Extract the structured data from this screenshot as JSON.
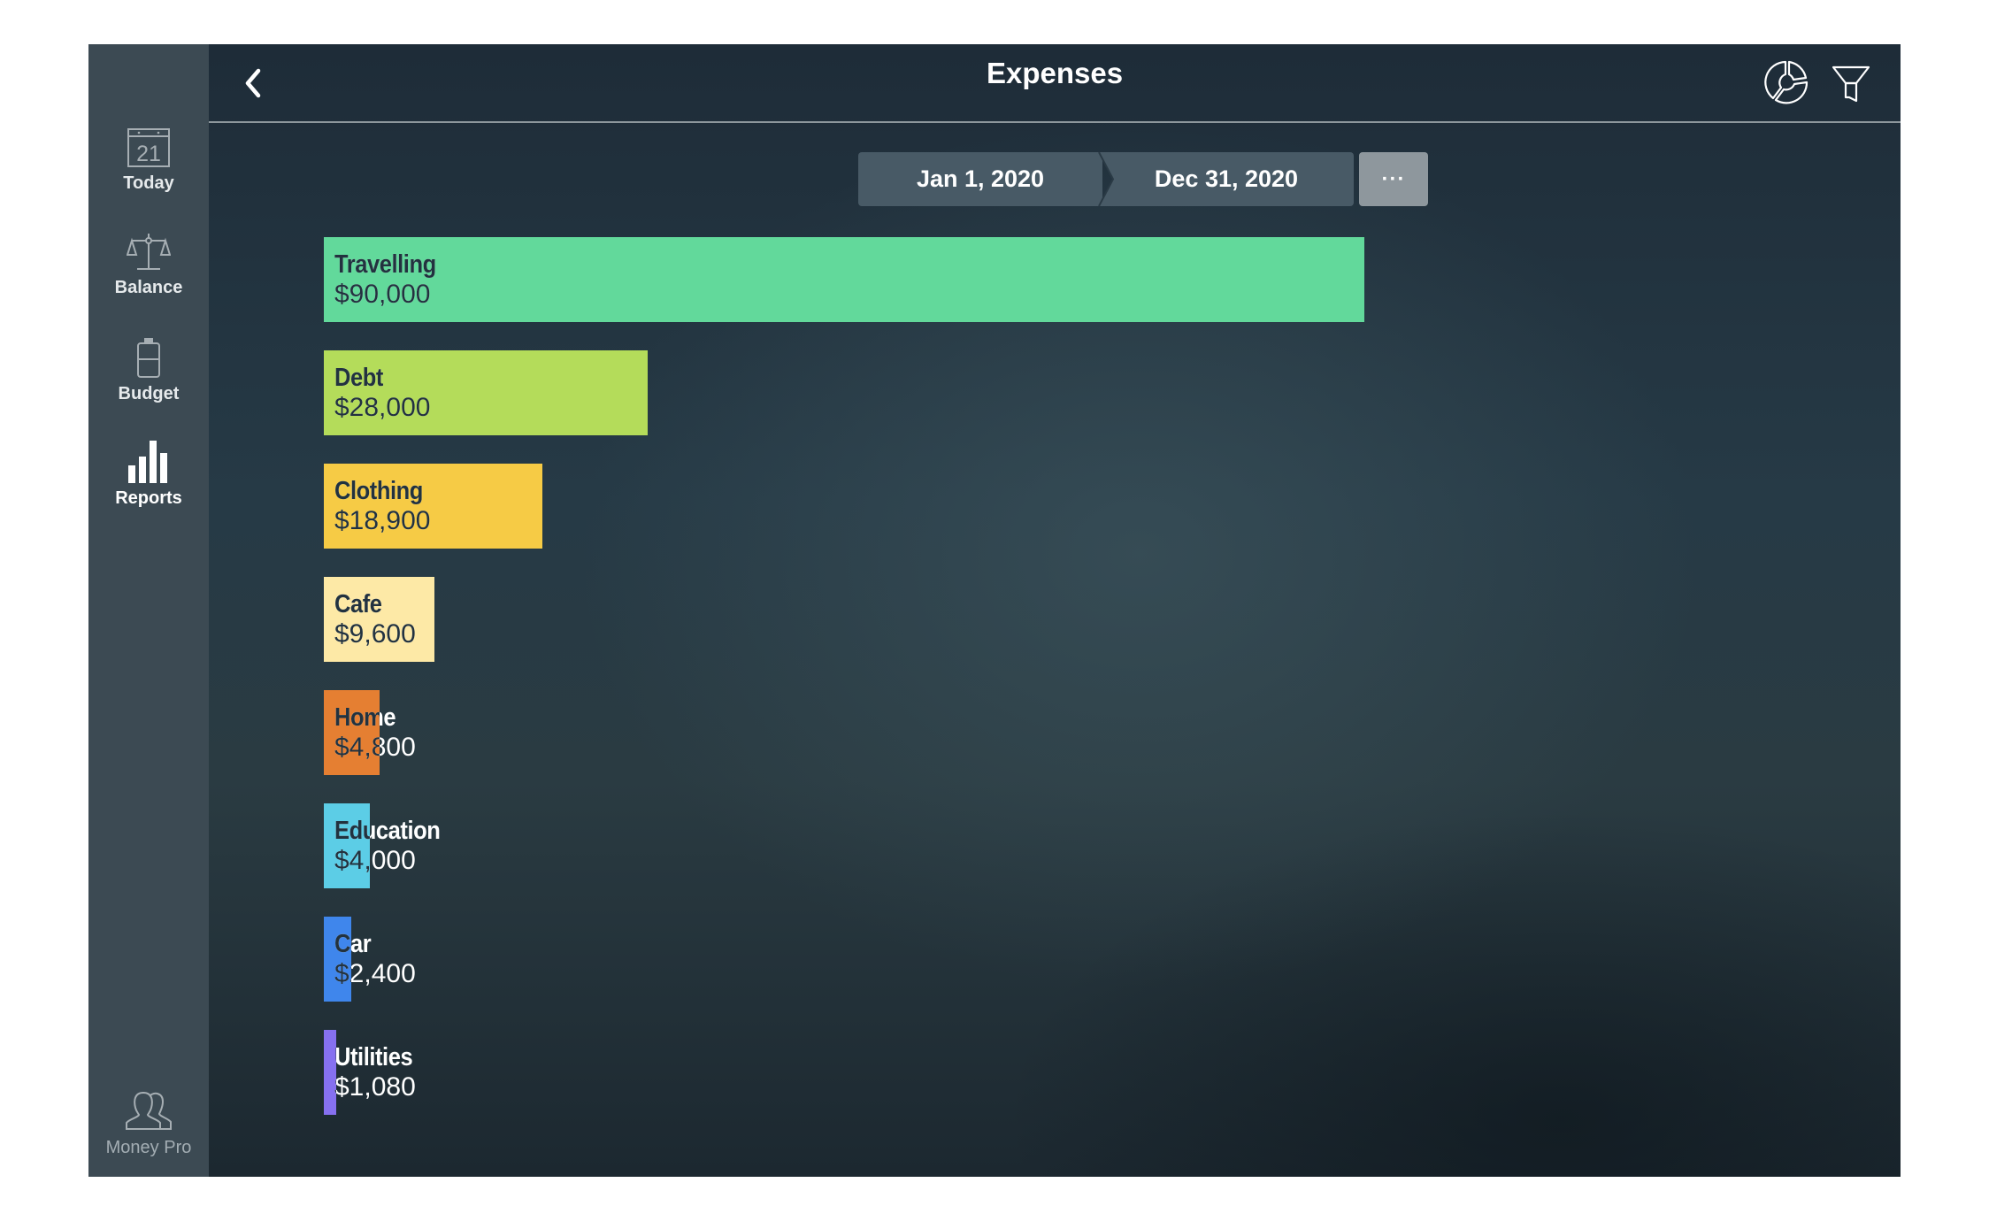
{
  "window": {
    "title": "Expenses"
  },
  "sidebar": {
    "items": [
      {
        "label": "Today",
        "icon": "calendar-icon",
        "icon_text": "21",
        "active": false
      },
      {
        "label": "Balance",
        "icon": "scales-icon",
        "active": false
      },
      {
        "label": "Budget",
        "icon": "battery-jar-icon",
        "active": false
      },
      {
        "label": "Reports",
        "icon": "bar-chart-icon",
        "active": true
      }
    ],
    "footer": {
      "label": "Money Pro",
      "icon": "users-icon"
    }
  },
  "header": {
    "title": "Expenses",
    "back_icon": "chevron-left-icon",
    "actions": [
      {
        "name": "chart-type",
        "icon": "donut-chart-icon"
      },
      {
        "name": "filter",
        "icon": "filter-funnel-icon"
      }
    ]
  },
  "date_range": {
    "start": "Jan 1, 2020",
    "end": "Dec 31, 2020",
    "more_label": "···"
  },
  "colors": {
    "travelling": "#62d99b",
    "debt": "#b4dc5a",
    "clothing": "#f6cb45",
    "cafe": "#fde9a6",
    "home": "#e57f32",
    "education": "#5ccde6",
    "car": "#3f86ec",
    "utilities": "#8670f0"
  },
  "chart_data": {
    "type": "bar",
    "orientation": "horizontal",
    "title": "Expenses",
    "categories": [
      "Travelling",
      "Debt",
      "Clothing",
      "Cafe",
      "Home",
      "Education",
      "Car",
      "Utilities"
    ],
    "values": [
      90000,
      28000,
      18900,
      9600,
      4800,
      4000,
      2400,
      1080
    ],
    "value_labels": [
      "$90,000",
      "$28,000",
      "$18,900",
      "$9,600",
      "$4,800",
      "$4,000",
      "$2,400",
      "$1,080"
    ],
    "bar_colors": [
      "#62d99b",
      "#b4dc5a",
      "#f6cb45",
      "#fde9a6",
      "#e57f32",
      "#5ccde6",
      "#3f86ec",
      "#8670f0"
    ],
    "xlim": [
      0,
      90000
    ],
    "xlabel": "",
    "ylabel": "",
    "grid": false,
    "legend": "none"
  }
}
